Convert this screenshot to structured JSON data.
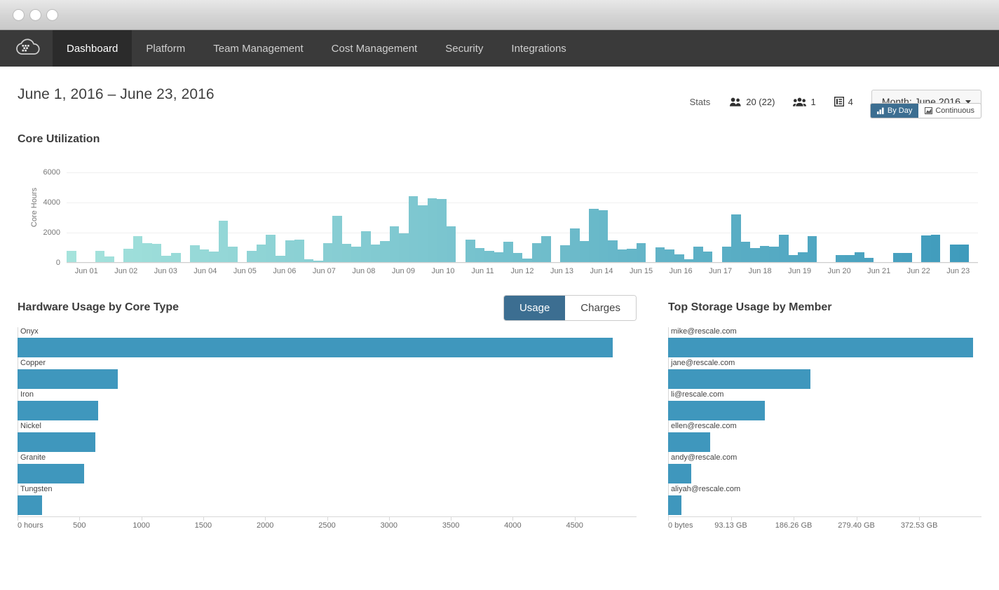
{
  "window": {
    "dots": [
      "close-dot",
      "minimize-dot",
      "maximize-dot"
    ]
  },
  "nav": {
    "logo_icon": "cloud-logo-icon",
    "items": [
      {
        "label": "Dashboard",
        "active": true
      },
      {
        "label": "Platform",
        "active": false
      },
      {
        "label": "Team Management",
        "active": false
      },
      {
        "label": "Cost Management",
        "active": false
      },
      {
        "label": "Security",
        "active": false
      },
      {
        "label": "Integrations",
        "active": false
      }
    ]
  },
  "header": {
    "date_range": "June 1, 2016 – June 23, 2016",
    "stats_label": "Stats",
    "stats": [
      {
        "icon": "users-icon",
        "value": "20 (22)"
      },
      {
        "icon": "group-icon",
        "value": "1"
      },
      {
        "icon": "list-icon",
        "value": "4"
      }
    ],
    "month_selector": "Month: June 2016",
    "granularity_toggle": [
      {
        "label": "By Day",
        "icon": "bar-chart-icon",
        "active": true
      },
      {
        "label": "Continuous",
        "icon": "area-chart-icon",
        "active": false
      }
    ]
  },
  "core_utilization": {
    "title": "Core Utilization"
  },
  "hardware": {
    "title": "Hardware Usage by Core Type",
    "toggle": [
      {
        "label": "Usage",
        "active": true
      },
      {
        "label": "Charges",
        "active": false
      }
    ]
  },
  "storage": {
    "title": "Top Storage Usage by Member"
  },
  "colors": {
    "bar_blue": "#3f97bd",
    "toggle_active": "#3c6e91",
    "navbar": "#3a3a3a",
    "navbar_active": "#2b2b2b",
    "chart_mint": "#a5e3dc",
    "chart_teal": "#46a2c4"
  },
  "chart_data": [
    {
      "type": "bar",
      "name": "core-utilization",
      "title": "Core Utilization",
      "xlabel": "",
      "ylabel": "Core Hours",
      "ylim": [
        0,
        6000
      ],
      "yticks": [
        0,
        2000,
        4000,
        6000
      ],
      "grid": true,
      "legend": "none",
      "xtick_labels": [
        "Jun 01",
        "Jun 02",
        "Jun 03",
        "Jun 04",
        "Jun 05",
        "Jun 06",
        "Jun 07",
        "Jun 08",
        "Jun 09",
        "Jun 10",
        "Jun 11",
        "Jun 12",
        "Jun 13",
        "Jun 14",
        "Jun 15",
        "Jun 16",
        "Jun 17",
        "Jun 18",
        "Jun 19",
        "Jun 20",
        "Jun 21",
        "Jun 22",
        "Jun 23"
      ],
      "note": "Three sub-bars per labelled day; color fades from mint (early June) to teal (late June).",
      "values": [
        800,
        0,
        0,
        800,
        420,
        0,
        930,
        1780,
        1320,
        1240,
        480,
        660,
        0,
        1180,
        880,
        760,
        2800,
        1050,
        0,
        790,
        1230,
        1870,
        470,
        1470,
        1530,
        240,
        120,
        1280,
        3110,
        1270,
        1090,
        2100,
        1200,
        1420,
        2400,
        1950,
        4400,
        3800,
        4300,
        4250,
        2420,
        0,
        1520,
        980,
        770,
        720,
        1390,
        640,
        300,
        1320,
        1780,
        0,
        1150,
        2280,
        1450,
        3560,
        3500,
        1480,
        880,
        950,
        1320,
        0,
        1030,
        880,
        560,
        230,
        1050,
        730,
        0,
        1080,
        3220,
        1390,
        960,
        1120,
        1090,
        1860,
        530,
        680,
        1790,
        0,
        0,
        490,
        530,
        690,
        340,
        0,
        0,
        640,
        640,
        0,
        1820,
        1840,
        0,
        1230,
        1210,
        0
      ]
    },
    {
      "type": "bar",
      "name": "hardware-usage-by-core-type",
      "orientation": "horizontal",
      "title": "Hardware Usage by Core Type",
      "xlabel": "hours",
      "ylabel": "",
      "xlim": [
        0,
        5000
      ],
      "xticks": [
        "0 hours",
        "500",
        "1000",
        "1500",
        "2000",
        "2500",
        "3000",
        "3500",
        "4000",
        "4500"
      ],
      "xtick_values": [
        0,
        500,
        1000,
        1500,
        2000,
        2500,
        3000,
        3500,
        4000,
        4500
      ],
      "categories": [
        "Onyx",
        "Copper",
        "Iron",
        "Nickel",
        "Granite",
        "Tungsten"
      ],
      "values": [
        4810,
        810,
        650,
        630,
        540,
        200
      ]
    },
    {
      "type": "bar",
      "name": "top-storage-usage-by-member",
      "orientation": "horizontal",
      "title": "Top Storage Usage by Member",
      "xlabel": "bytes",
      "ylabel": "",
      "xlim": [
        0,
        465
      ],
      "xunit": "GB",
      "xticks": [
        "0 bytes",
        "93.13 GB",
        "186.26 GB",
        "279.40 GB",
        "372.53 GB"
      ],
      "xtick_values": [
        0,
        93.13,
        186.26,
        279.4,
        372.53
      ],
      "categories": [
        "mike@rescale.com",
        "jane@rescale.com",
        "li@rescale.com",
        "ellen@rescale.com",
        "andy@rescale.com",
        "aliyah@rescale.com"
      ],
      "values": [
        453,
        211,
        144,
        62,
        34,
        20
      ]
    }
  ]
}
